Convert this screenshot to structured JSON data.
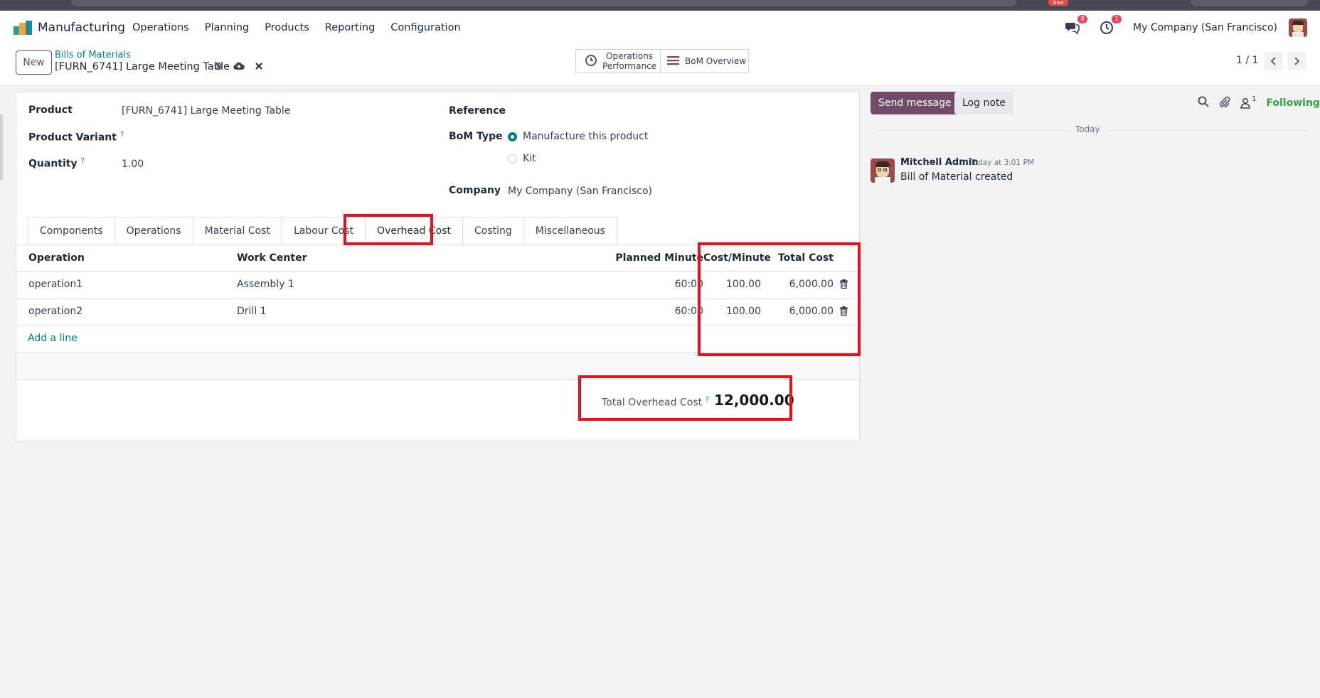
{
  "app": {
    "name": "Manufacturing",
    "menu": [
      "Operations",
      "Planning",
      "Products",
      "Reporting",
      "Configuration"
    ],
    "messages_badge": "8",
    "activities_badge": "1",
    "company": "My Company (San Francisco)",
    "chrome_badge": "New"
  },
  "control": {
    "new_label": "New",
    "breadcrumb_parent": "Bills of Materials",
    "breadcrumb_current": "[FURN_6741] Large Meeting Table",
    "smart_ops_line1": "Operations",
    "smart_ops_line2": "Performance",
    "smart_bom": "BoM Overview",
    "pager": "1 / 1"
  },
  "form": {
    "product_label": "Product",
    "product_value": "[FURN_6741] Large Meeting Table",
    "variant_label": "Product Variant",
    "quantity_label": "Quantity",
    "quantity_value": "1.00",
    "help_mark": "?",
    "reference_label": "Reference",
    "bom_type_label": "BoM Type",
    "bom_type_options": [
      "Manufacture this product",
      "Kit"
    ],
    "bom_type_selected": "Manufacture this product",
    "company_label": "Company",
    "company_value": "My Company (San Francisco)"
  },
  "tabs": [
    "Components",
    "Operations",
    "Material Cost",
    "Labour Cost",
    "Overhead Cost",
    "Costing",
    "Miscellaneous"
  ],
  "active_tab": "Overhead Cost",
  "table": {
    "columns": [
      "Operation",
      "Work Center",
      "Planned Minute",
      "Cost/Minute",
      "Total Cost"
    ],
    "rows": [
      {
        "operation": "operation1",
        "work_center": "Assembly 1",
        "planned_minute": "60:00",
        "cost_minute": "100.00",
        "total_cost": "6,000.00"
      },
      {
        "operation": "operation2",
        "work_center": "Drill 1",
        "planned_minute": "60:00",
        "cost_minute": "100.00",
        "total_cost": "6,000.00"
      }
    ],
    "add_line": "Add a line"
  },
  "totals": {
    "label": "Total Overhead Cost",
    "value": "12,000.00"
  },
  "chatter": {
    "send_message": "Send message",
    "log_note": "Log note",
    "followers_count": "1",
    "following": "Following",
    "separator": "Today",
    "message": {
      "author": "Mitchell Admin",
      "time": "Today at 3:01 PM",
      "body": "Bill of Material created"
    }
  },
  "colors": {
    "brand": "#714b67",
    "link": "#017e84",
    "highlight": "#e8101a",
    "following": "#28a745"
  }
}
